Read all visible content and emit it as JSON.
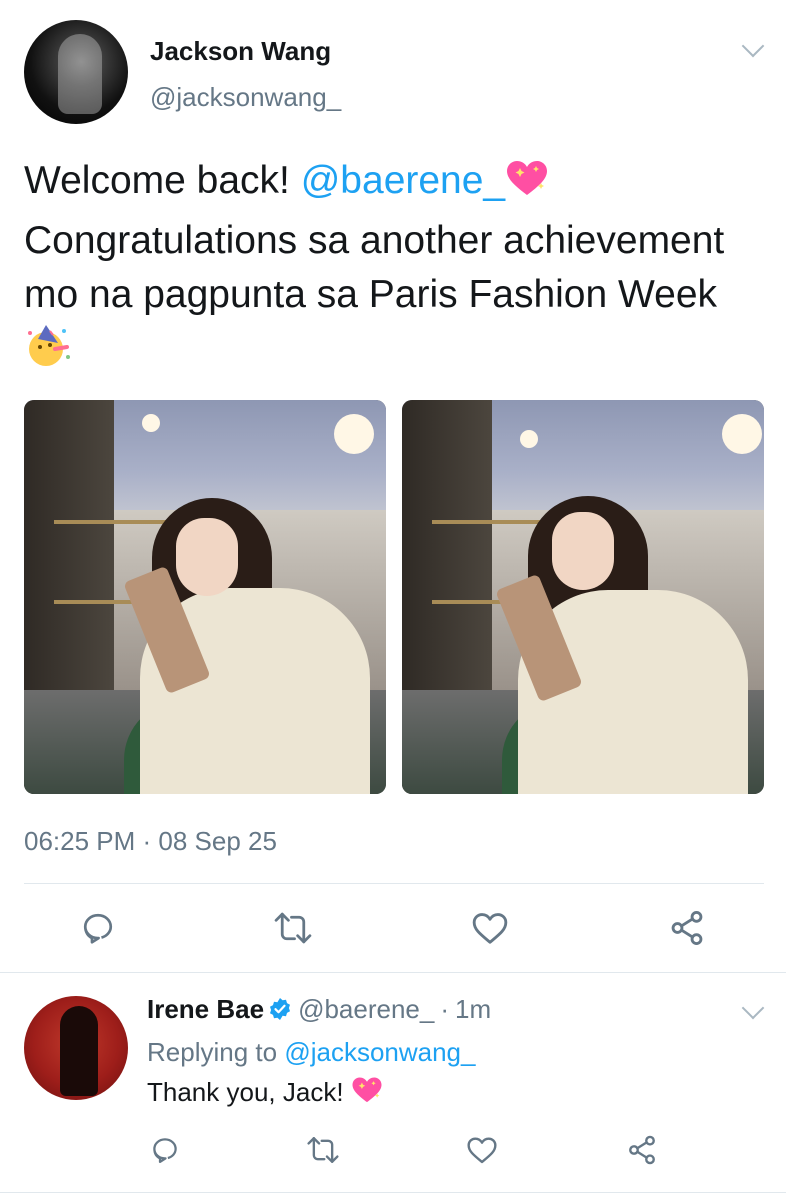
{
  "tweet": {
    "author_name": "Jackson Wang",
    "author_handle": "@jacksonwang_",
    "text_part1": "Welcome back! ",
    "mention": "@baerene_",
    "text_part2": " Congratulations sa another achievement mo na pagpunta sa Paris Fashion Week ",
    "timestamp": "06:25 PM · 08 Sep 25"
  },
  "reply": {
    "author_name": "Irene Bae",
    "author_handle": "@baerene_",
    "separator": "·",
    "time": "1m",
    "replying_prefix": "Replying to ",
    "replying_to": "@jacksonwang_",
    "text": "Thank you, Jack! "
  },
  "icons": {
    "reply": "reply-icon",
    "retweet": "retweet-icon",
    "like": "heart-icon",
    "share": "share-icon",
    "verified": "verified-badge-icon",
    "sparkle_heart": "sparkling-heart-emoji",
    "party_face": "partying-face-emoji"
  },
  "colors": {
    "accent": "#1da1f2",
    "secondary_text": "#657786",
    "primary_text": "#14171a"
  }
}
